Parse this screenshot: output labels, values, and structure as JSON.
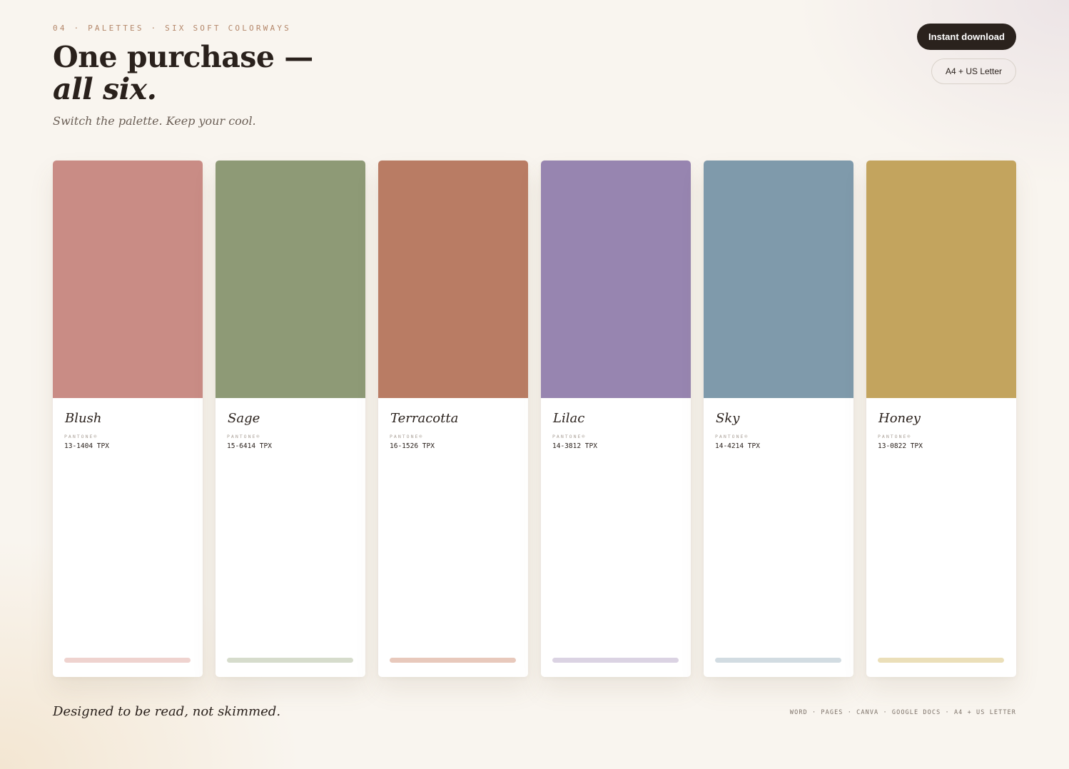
{
  "header": {
    "eyebrow": "04 · PALETTES · SIX SOFT COLORWAYS",
    "headline_line1": "One purchase —",
    "headline_line2": "all six.",
    "subtitle": "Switch the palette. Keep your cool."
  },
  "actions": {
    "download_label": "Instant download",
    "format_label": "A4 + US Letter"
  },
  "palettes": [
    {
      "name": "Blush",
      "pantone_label": "PANTONE®",
      "code": "13-1404 TPX",
      "color": "#c98c85",
      "tint": "#efd3cf"
    },
    {
      "name": "Sage",
      "pantone_label": "PANTONE®",
      "code": "15-6414 TPX",
      "color": "#8e9a76",
      "tint": "#d6dccc"
    },
    {
      "name": "Terracotta",
      "pantone_label": "PANTONE®",
      "code": "16-1526 TPX",
      "color": "#b97c64",
      "tint": "#e8c9bc"
    },
    {
      "name": "Lilac",
      "pantone_label": "PANTONE®",
      "code": "14-3812 TPX",
      "color": "#9785b0",
      "tint": "#dbd3e3"
    },
    {
      "name": "Sky",
      "pantone_label": "PANTONE®",
      "code": "14-4214 TPX",
      "color": "#7f9aab",
      "tint": "#d2dce2"
    },
    {
      "name": "Honey",
      "pantone_label": "PANTONE®",
      "code": "13-0822 TPX",
      "color": "#c3a45e",
      "tint": "#ebdfb9"
    }
  ],
  "footer": {
    "tagline": "Designed to be read, not skimmed.",
    "formats": "WORD · PAGES · CANVA · GOOGLE DOCS · A4 + US LETTER"
  }
}
